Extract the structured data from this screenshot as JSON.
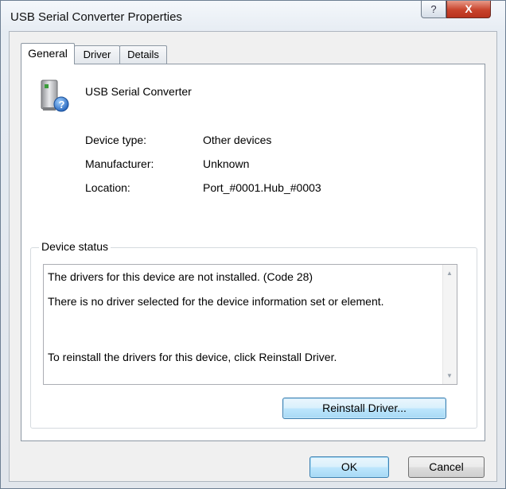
{
  "window": {
    "title": "USB Serial Converter Properties",
    "help_label": "?",
    "close_label": "X"
  },
  "tabs": [
    {
      "label": "General"
    },
    {
      "label": "Driver"
    },
    {
      "label": "Details"
    }
  ],
  "device": {
    "icon": "device-unknown-icon",
    "name": "USB Serial Converter"
  },
  "properties": [
    {
      "label": "Device type:",
      "value": "Other devices"
    },
    {
      "label": "Manufacturer:",
      "value": "Unknown"
    },
    {
      "label": "Location:",
      "value": "Port_#0001.Hub_#0003"
    }
  ],
  "status": {
    "legend": "Device status",
    "lines": [
      "The drivers for this device are not installed. (Code 28)",
      "There is no driver selected for the device information set or element.",
      "To reinstall the drivers for this device, click Reinstall Driver."
    ],
    "reinstall_label": "Reinstall Driver..."
  },
  "footer": {
    "ok_label": "OK",
    "cancel_label": "Cancel"
  }
}
